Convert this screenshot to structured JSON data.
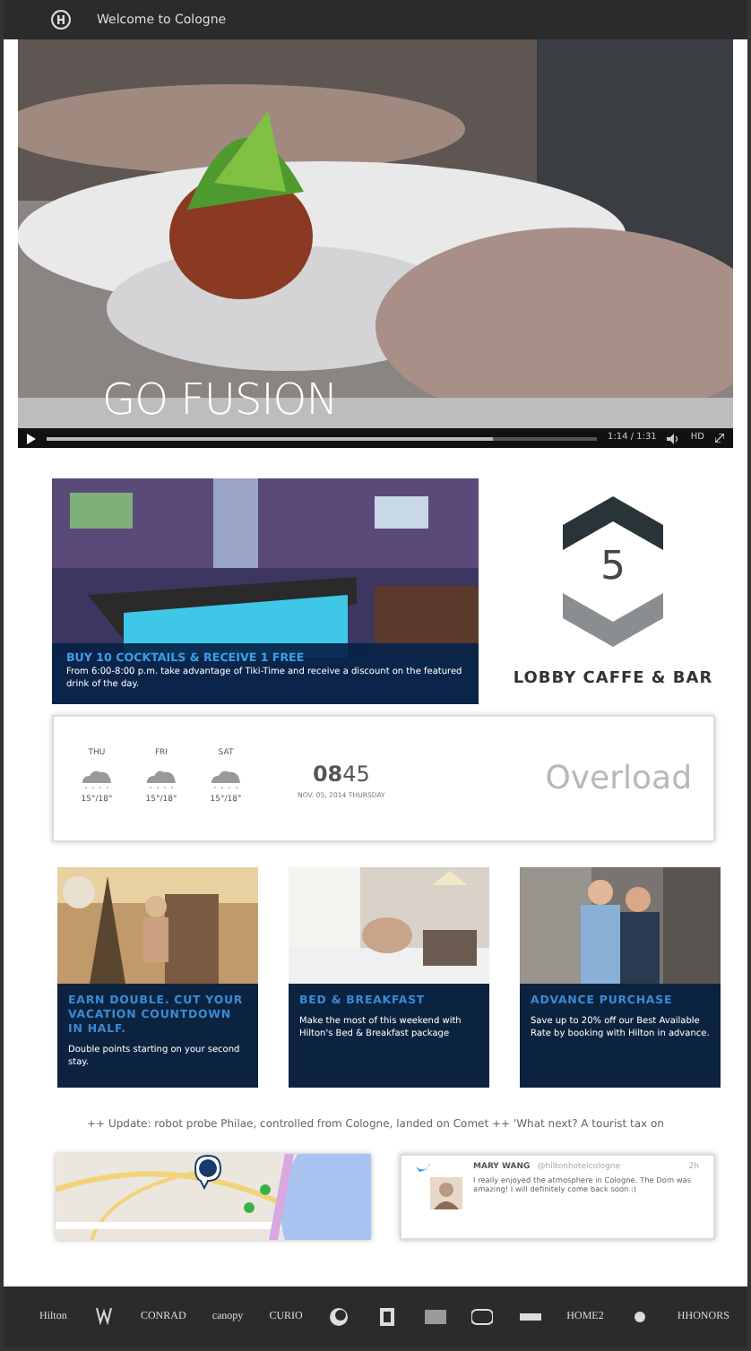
{
  "top_bar": {
    "title": "Welcome to Cologne"
  },
  "video": {
    "caption": "GO FUSION",
    "time": "1:14 / 1:31",
    "level": 0.81,
    "quality": "HD"
  },
  "promo": {
    "headline": "BUY 10 COCKTAILS  & RECEIVE 1 FREE",
    "text": "From 6:00-8:00 p.m. take advantage of Tiki-Time and receive a discount on the featured drink of the day."
  },
  "venue": {
    "number": "5",
    "name": "LOBBY CAFFE & BAR"
  },
  "weather": [
    {
      "day": "THU",
      "temp": "15°/18°"
    },
    {
      "day": "FRI",
      "temp": "15°/18°"
    },
    {
      "day": "SAT",
      "temp": "15°/18°"
    }
  ],
  "clock": {
    "hours": "08",
    "minutes": "45",
    "date": "NOV. 05, 2014 THURSDAY"
  },
  "overload": "Overload",
  "offers": [
    {
      "title": "EARN DOUBLE. CUT YOUR VACATION COUNTDOWN IN HALF.",
      "text": "Double points starting on your second stay."
    },
    {
      "title": "BED & BREAKFAST",
      "text": "Make the most of this weekend with Hilton's Bed & Breakfast package"
    },
    {
      "title": "ADVANCE PURCHASE",
      "text": "Save up to 20% off our Best Available Rate by booking with Hilton in advance."
    }
  ],
  "ticker": "++ Update: robot probe Philae, controlled from Cologne, landed on Comet ++ 'What next? A tourist tax on",
  "tweet": {
    "name": "MARY WANG",
    "handle": "@hiltonhotelcologne",
    "age": "2h",
    "text": "I really enjoyed the atmosphere in Cologne. The Dom was amazing!  I will definitely come back soon :)"
  },
  "brands": [
    {
      "kind": "text",
      "label": "Hilton"
    },
    {
      "kind": "icon"
    },
    {
      "kind": "text",
      "label": "CONRAD"
    },
    {
      "kind": "text",
      "label": "canopy"
    },
    {
      "kind": "text",
      "label": "CURIO"
    },
    {
      "kind": "icon"
    },
    {
      "kind": "icon"
    },
    {
      "kind": "icon"
    },
    {
      "kind": "icon"
    },
    {
      "kind": "icon"
    },
    {
      "kind": "text",
      "label": "HOME2"
    },
    {
      "kind": "icon"
    },
    {
      "kind": "text",
      "label": "HHONORS"
    }
  ]
}
